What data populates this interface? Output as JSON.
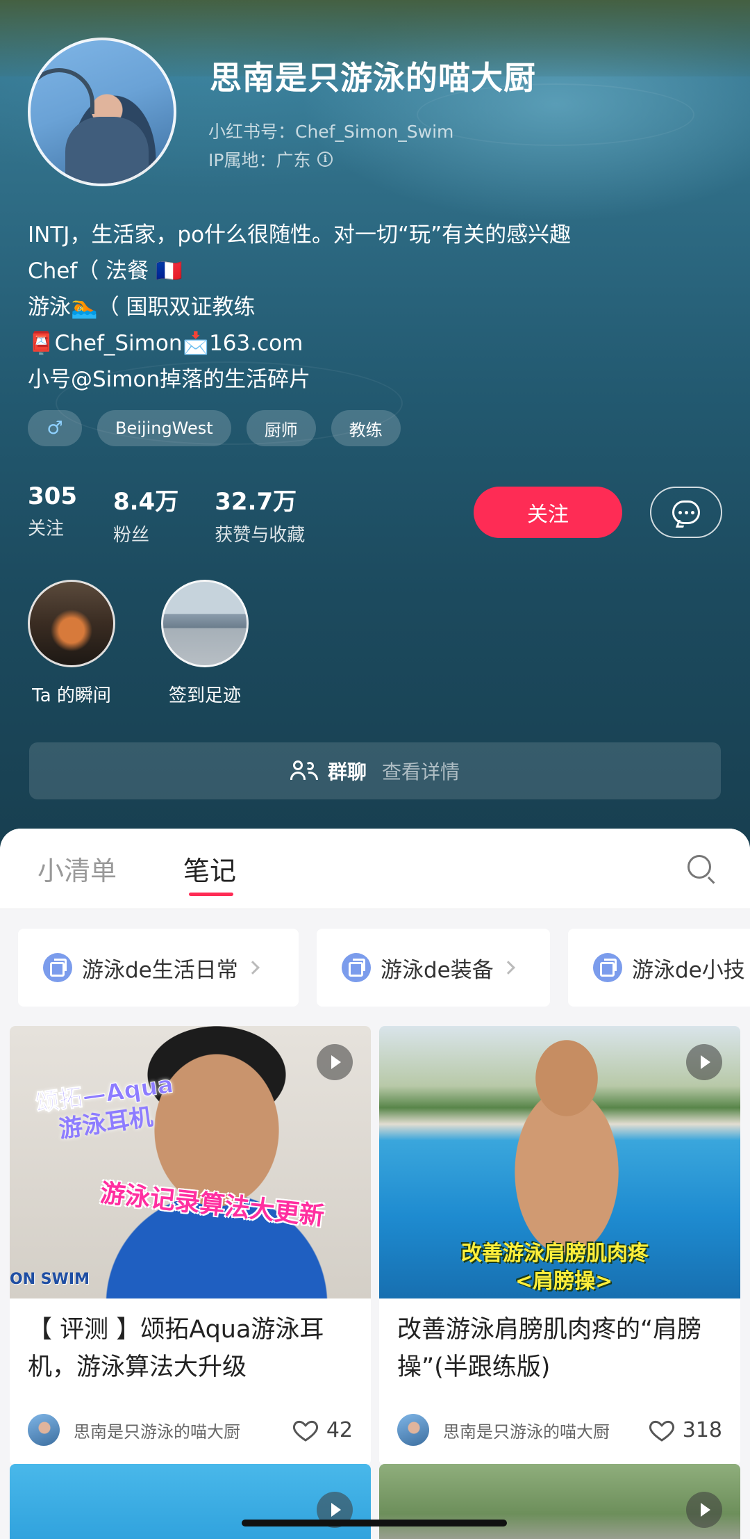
{
  "profile": {
    "name": "思南是只游泳的喵大厨",
    "id_line": "小红书号：Chef_Simon_Swim",
    "ip_line": "IP属地：广东",
    "bio": [
      "INTJ，生活家，po什么很随性。对一切“玩”有关的感兴趣",
      "Chef（ 法餐 🇫🇷",
      "游泳🏊（ 国职双证教练",
      "📮Chef_Simon📩163.com",
      "小号@Simon掉落的生活碎片"
    ],
    "tags": [
      "♂",
      "BeijingWest",
      "厨师",
      "教练"
    ]
  },
  "stats": [
    {
      "value": "305",
      "label": "关注"
    },
    {
      "value": "8.4万",
      "label": "粉丝"
    },
    {
      "value": "32.7万",
      "label": "获赞与收藏"
    }
  ],
  "actions": {
    "follow_label": "关注"
  },
  "moments": [
    {
      "caption": "Ta 的瞬间"
    },
    {
      "caption": "签到足迹"
    }
  ],
  "group": {
    "title": "群聊",
    "detail": "查看详情"
  },
  "tabs": [
    "小清单",
    "笔记"
  ],
  "collections": [
    {
      "label": "游泳de生活日常"
    },
    {
      "label": "游泳de装备"
    },
    {
      "label": "游泳de小技"
    }
  ],
  "notes": [
    {
      "title": "【 评测 】颂拓Aqua游泳耳机，游泳算法大升级",
      "author": "思南是只游泳的喵大厨",
      "likes": "42",
      "cover_text": [
        "颂拓—Aqua",
        "游泳耳机",
        "游泳记录算法大更新",
        "ON SWIM"
      ]
    },
    {
      "title": "改善游泳肩膀肌肉疼的“肩膀操”(半跟练版)",
      "author": "思南是只游泳的喵大厨",
      "likes": "318",
      "cover_text": [
        "改善游泳肩膀肌肉疼",
        "<肩膀操>"
      ]
    }
  ],
  "colors": {
    "accent": "#fe2c55",
    "header_bg": "#235a71",
    "collection_icon": "#7b9cec"
  },
  "icons": {
    "info": "info-icon",
    "message": "chat-bubble-icon",
    "group": "people-icon",
    "search": "search-icon",
    "play": "play-icon",
    "like": "heart-icon"
  }
}
